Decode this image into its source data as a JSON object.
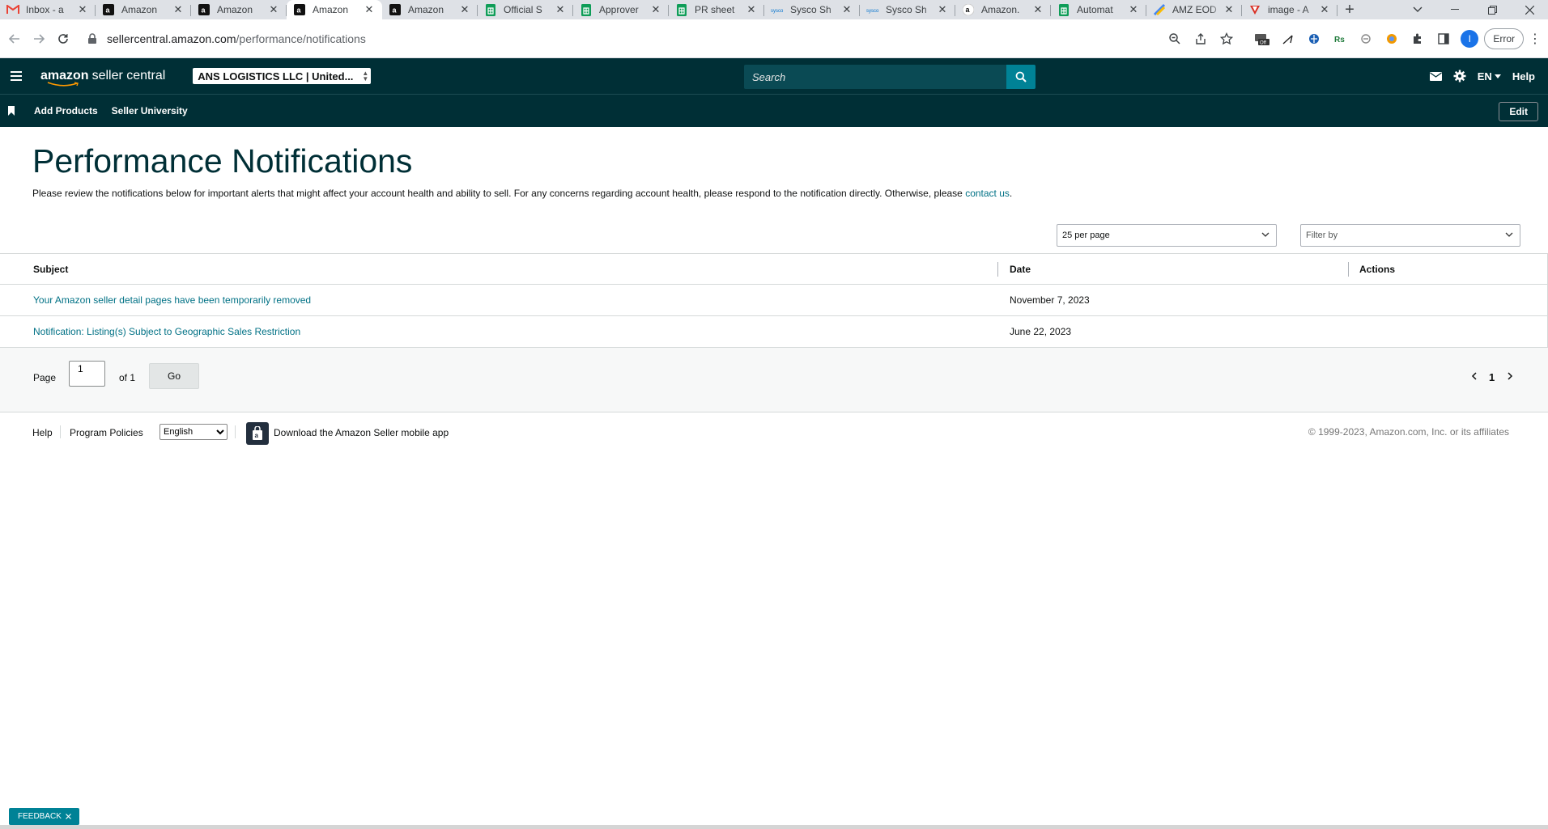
{
  "browser": {
    "tabs": [
      {
        "title": "Inbox - a",
        "icon": "gmail-icon"
      },
      {
        "title": "Amazon",
        "icon": "amazon-icon"
      },
      {
        "title": "Amazon",
        "icon": "amazon-icon"
      },
      {
        "title": "Amazon",
        "icon": "amazon-icon",
        "active": true
      },
      {
        "title": "Amazon",
        "icon": "amazon-icon"
      },
      {
        "title": "Official S",
        "icon": "sheets-icon"
      },
      {
        "title": "Approver",
        "icon": "sheets-icon"
      },
      {
        "title": "PR sheet",
        "icon": "sheets-icon"
      },
      {
        "title": "Sysco Sh",
        "icon": "sysco-icon"
      },
      {
        "title": "Sysco Sh",
        "icon": "sysco-icon"
      },
      {
        "title": "Amazon.",
        "icon": "amazon-smile-icon"
      },
      {
        "title": "Automat",
        "icon": "sheets-icon"
      },
      {
        "title": "AMZ EOD",
        "icon": "colorful-icon"
      },
      {
        "title": "image - A",
        "icon": "v-icon"
      }
    ],
    "url_host": "sellercentral.amazon.com",
    "url_path": "/performance/notifications",
    "profile_initial": "I",
    "error_label": "Error"
  },
  "header": {
    "logo_brand": "amazon",
    "logo_product": "seller central",
    "account": "ANS LOGISTICS LLC | United...",
    "search_placeholder": "Search",
    "lang": "EN",
    "help": "Help"
  },
  "nav": {
    "items": [
      "Add Products",
      "Seller University"
    ],
    "edit": "Edit"
  },
  "page": {
    "title": "Performance Notifications",
    "description": "Please review the notifications below for important alerts that might affect your account health and ability to sell. For any concerns regarding account health, please respond to the notification directly. Otherwise, please ",
    "contact_link": "contact us",
    "description_end": "."
  },
  "controls": {
    "per_page": "25 per page",
    "filter_placeholder": "Filter by"
  },
  "table": {
    "headers": [
      "Subject",
      "Date",
      "Actions"
    ],
    "rows": [
      {
        "subject": "Your Amazon seller detail pages have been temporarily removed",
        "date": "November 7, 2023",
        "actions": ""
      },
      {
        "subject": "Notification: Listing(s) Subject to Geographic Sales Restriction",
        "date": "June 22, 2023",
        "actions": ""
      }
    ]
  },
  "pager": {
    "page_label": "Page",
    "page_value": "1",
    "of_label": "of 1",
    "go": "Go",
    "current": "1"
  },
  "footer": {
    "help": "Help",
    "policies": "Program Policies",
    "language": "English",
    "app_text": "Download the Amazon Seller mobile app",
    "copyright": "© 1999-2023, Amazon.com, Inc. or its affiliates"
  },
  "feedback": "FEEDBACK",
  "colors": {
    "header_bg": "#002f36",
    "accent": "#008296",
    "link": "#007185"
  }
}
